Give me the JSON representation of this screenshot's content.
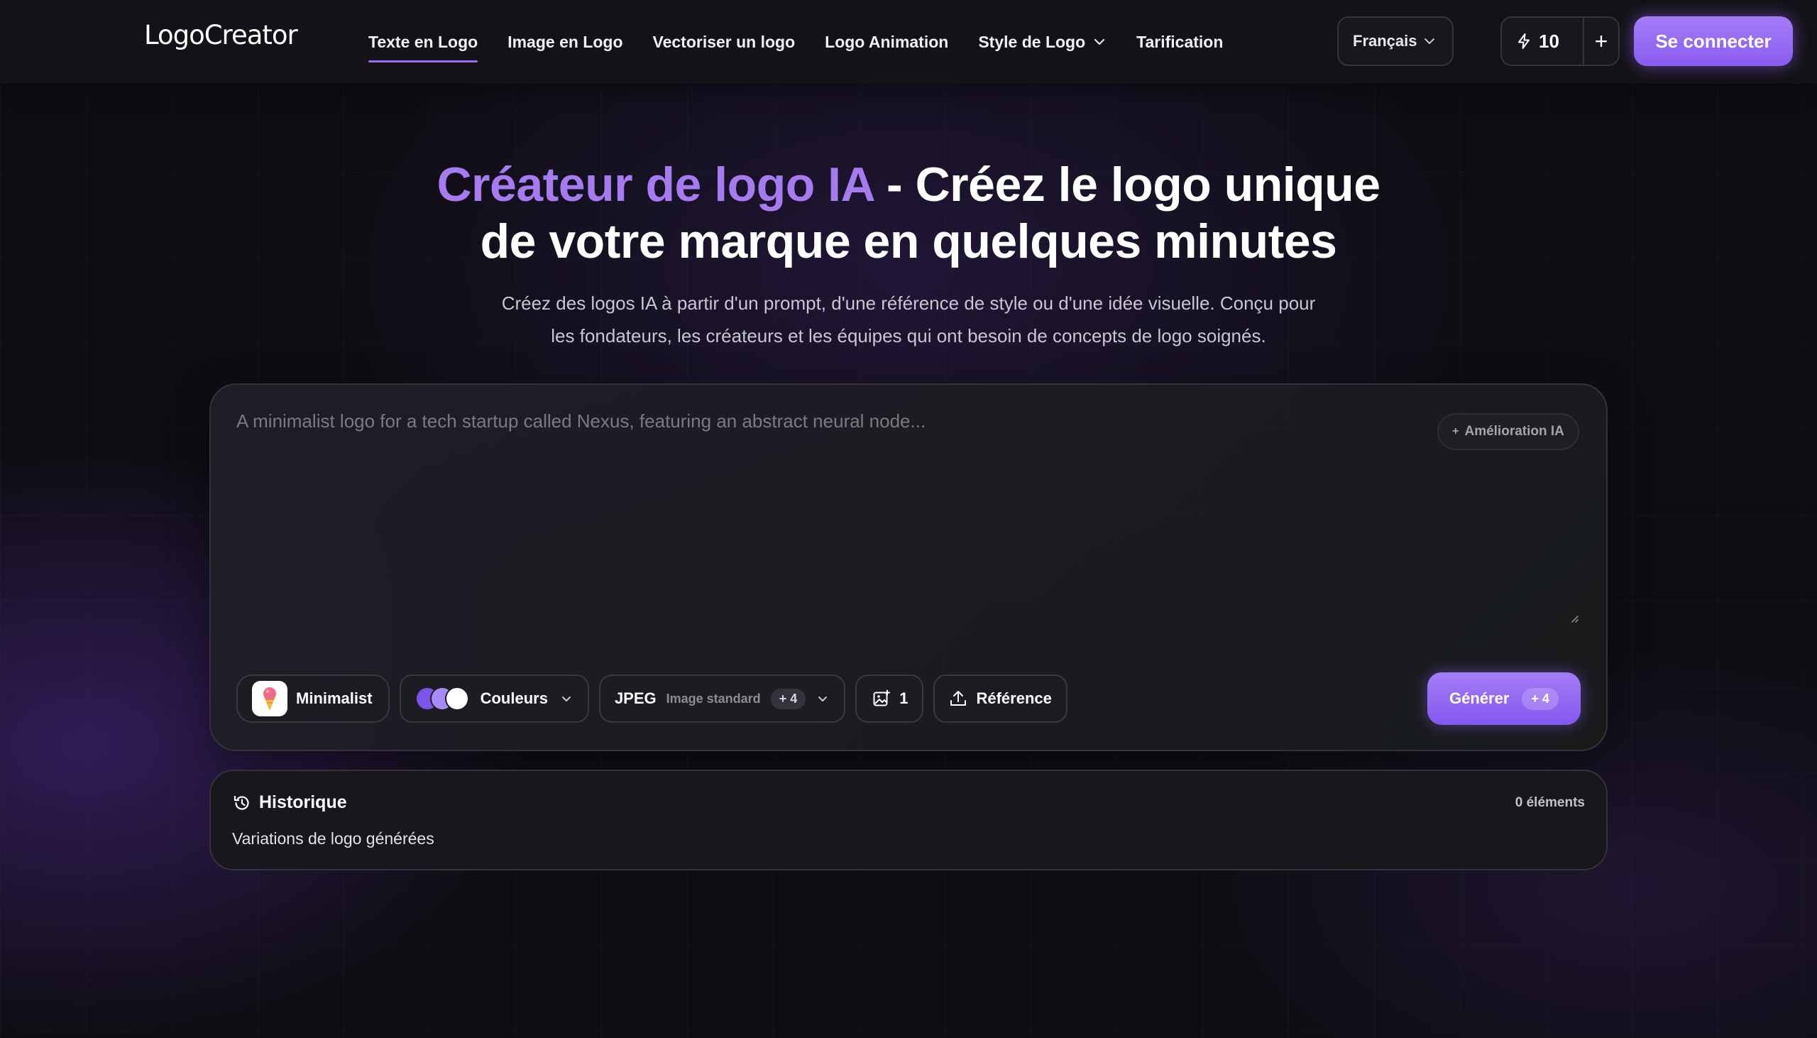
{
  "brand": {
    "logo_text": "LogoCreator"
  },
  "nav": {
    "items": [
      {
        "label": "Texte en Logo"
      },
      {
        "label": "Image en Logo"
      },
      {
        "label": "Vectoriser un logo"
      },
      {
        "label": "Logo Animation"
      },
      {
        "label": "Style de Logo"
      },
      {
        "label": "Tarification"
      }
    ],
    "active_index": 0
  },
  "header": {
    "language": "Français",
    "credits": "10",
    "add_credits": "+",
    "login_label": "Se connecter"
  },
  "hero": {
    "title_accent": "Créateur de logo IA",
    "title_rest": " - Créez le logo unique",
    "title_line2": "de votre marque en quelques minutes",
    "subtitle_line1": "Créez des logos IA à partir d'un prompt, d'une référence de style ou d'une idée visuelle. Conçu pour",
    "subtitle_line2": "les fondateurs, les créateurs et les équipes qui ont besoin de concepts de logo soignés."
  },
  "prompt": {
    "placeholder": "A minimalist logo for a tech startup called Nexus, featuring an abstract neural node...",
    "value": "",
    "enhance_label": "Amélioration IA",
    "enhance_prefix": "+"
  },
  "toolbar": {
    "style_label": "Minimalist",
    "colors_label": "Couleurs",
    "format_label": "JPEG",
    "format_quality": "Image standard",
    "format_cost": "+ 4",
    "image_count": "1",
    "reference_label": "Référence",
    "generate_label": "Générer",
    "generate_cost": "+ 4",
    "swatch_colors": [
      "#7b55e8",
      "#a78af5",
      "#ffffff"
    ]
  },
  "history": {
    "title": "Historique",
    "subtitle": "Variations de logo générées",
    "count_label": "0 éléments"
  },
  "colors": {
    "accent": "#a57bef",
    "button": "#8a5cf0"
  }
}
